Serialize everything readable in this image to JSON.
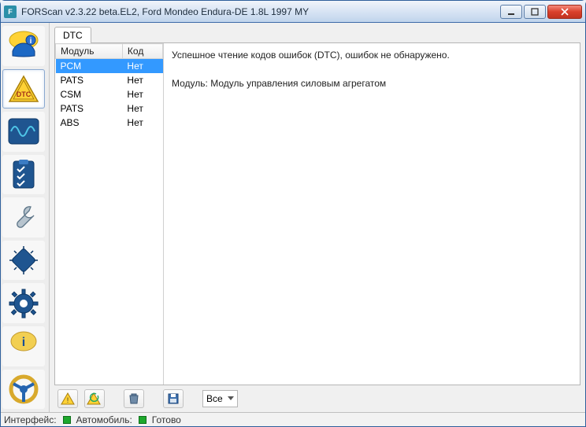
{
  "window": {
    "title": "FORScan v2.3.22 beta.EL2, Ford Mondeo Endura-DE 1.8L 1997 MY"
  },
  "sidebar": {
    "items": [
      {
        "name": "vehicle-info"
      },
      {
        "name": "dtc"
      },
      {
        "name": "oscilloscope"
      },
      {
        "name": "tests"
      },
      {
        "name": "service"
      },
      {
        "name": "obd"
      },
      {
        "name": "settings"
      },
      {
        "name": "help"
      },
      {
        "name": "steering"
      }
    ]
  },
  "tab": {
    "label": "DTC"
  },
  "grid": {
    "headers": {
      "module": "Модуль",
      "code": "Код"
    },
    "rows": [
      {
        "module": "PCM",
        "code": "Нет",
        "selected": true
      },
      {
        "module": "PATS",
        "code": "Нет"
      },
      {
        "module": "CSM",
        "code": "Нет"
      },
      {
        "module": "PATS",
        "code": "Нет"
      },
      {
        "module": "ABS",
        "code": "Нет"
      }
    ]
  },
  "detail": {
    "line1": "Успешное чтение кодов ошибок (DTC), ошибок не обнаружено.",
    "line2": "Модуль: Модуль управления силовым агрегатом"
  },
  "actionbar": {
    "dropdown_label": "Все"
  },
  "statusbar": {
    "interface_label": "Интерфейс:",
    "vehicle_label": "Автомобиль:",
    "ready_label": "Готово"
  }
}
